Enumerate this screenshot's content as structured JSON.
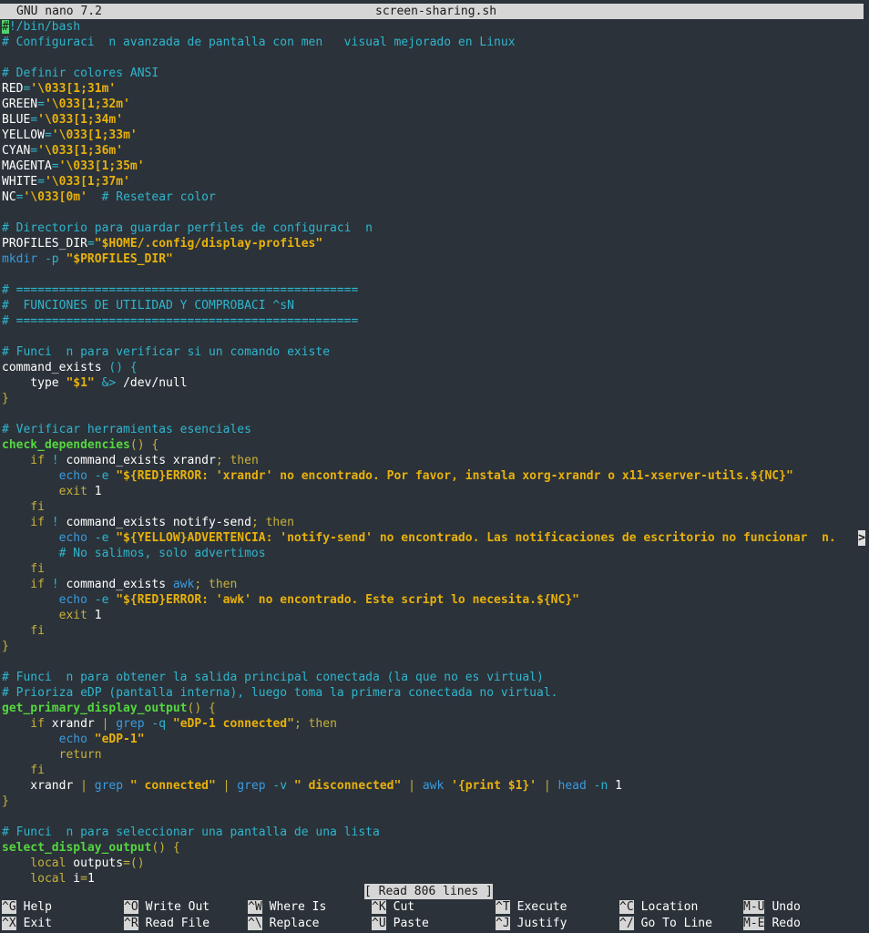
{
  "titlebar": {
    "app": "GNU nano 7.2",
    "file": "screen-sharing.sh"
  },
  "lines": [
    [
      [
        "cursor",
        "#"
      ],
      [
        "cmt",
        "!/bin/bash"
      ]
    ],
    [
      [
        "cmt",
        "# Configuraci  n avanzada de pantalla con men   visual mejorado en Linux"
      ]
    ],
    [],
    [
      [
        "cmt",
        "# Definir colores ANSI"
      ]
    ],
    [
      [
        "w",
        "RED"
      ],
      [
        "cmt",
        "="
      ],
      [
        "str",
        "'\\033[1;31m'"
      ]
    ],
    [
      [
        "w",
        "GREEN"
      ],
      [
        "cmt",
        "="
      ],
      [
        "str",
        "'\\033[1;32m'"
      ]
    ],
    [
      [
        "w",
        "BLUE"
      ],
      [
        "cmt",
        "="
      ],
      [
        "str",
        "'\\033[1;34m'"
      ]
    ],
    [
      [
        "w",
        "YELLOW"
      ],
      [
        "cmt",
        "="
      ],
      [
        "str",
        "'\\033[1;33m'"
      ]
    ],
    [
      [
        "w",
        "CYAN"
      ],
      [
        "cmt",
        "="
      ],
      [
        "str",
        "'\\033[1;36m'"
      ]
    ],
    [
      [
        "w",
        "MAGENTA"
      ],
      [
        "cmt",
        "="
      ],
      [
        "str",
        "'\\033[1;35m'"
      ]
    ],
    [
      [
        "w",
        "WHITE"
      ],
      [
        "cmt",
        "="
      ],
      [
        "str",
        "'\\033[1;37m'"
      ]
    ],
    [
      [
        "w",
        "NC"
      ],
      [
        "cmt",
        "="
      ],
      [
        "str",
        "'\\033[0m'"
      ],
      [
        "cmt",
        "  # Resetear color"
      ]
    ],
    [],
    [
      [
        "cmt",
        "# Directorio para guardar perfiles de configuraci  n"
      ]
    ],
    [
      [
        "w",
        "PROFILES_DIR"
      ],
      [
        "cmt",
        "="
      ],
      [
        "str",
        "\"$HOME/.config/display-profiles\""
      ]
    ],
    [
      [
        "cmd",
        "mkdir"
      ],
      [
        "cmt",
        " -p "
      ],
      [
        "str",
        "\"$PROFILES_DIR\""
      ]
    ],
    [],
    [
      [
        "cmt",
        "# ================================================"
      ]
    ],
    [
      [
        "cmt",
        "#  FUNCIONES DE UTILIDAD Y COMPROBACI ^sN"
      ]
    ],
    [
      [
        "cmt",
        "# ================================================"
      ]
    ],
    [],
    [
      [
        "cmt",
        "# Funci  n para verificar si un comando existe"
      ]
    ],
    [
      [
        "w",
        "command_exists"
      ],
      [
        "cmt",
        " () {"
      ]
    ],
    [
      [
        "w",
        "    type "
      ],
      [
        "str",
        "\"$1\""
      ],
      [
        "cmt",
        " &> "
      ],
      [
        "w",
        "/dev/null"
      ]
    ],
    [
      [
        "kw",
        "}"
      ]
    ],
    [],
    [
      [
        "cmt",
        "# Verificar herramientas esenciales"
      ]
    ],
    [
      [
        "fn",
        "check_dependencies"
      ],
      [
        "kw",
        "() {"
      ]
    ],
    [
      [
        "kw",
        "    if "
      ],
      [
        "cmt",
        "! "
      ],
      [
        "w",
        "command_exists xrandr"
      ],
      [
        "kw",
        "; then"
      ]
    ],
    [
      [
        "cmd",
        "        echo"
      ],
      [
        "cmt",
        " -e "
      ],
      [
        "str",
        "\"${RED}ERROR: 'xrandr' no encontrado. Por favor, instala xorg-xrandr o x11-xserver-utils.${NC}\""
      ]
    ],
    [
      [
        "kw",
        "        exit "
      ],
      [
        "w",
        "1"
      ]
    ],
    [
      [
        "kw",
        "    fi"
      ]
    ],
    [
      [
        "kw",
        "    if "
      ],
      [
        "cmt",
        "! "
      ],
      [
        "w",
        "command_exists notify-send"
      ],
      [
        "kw",
        "; then"
      ]
    ],
    [
      [
        "cmd",
        "        echo"
      ],
      [
        "cmt",
        " -e "
      ],
      [
        "str",
        "\"${YELLOW}ADVERTENCIA: 'notify-send' no encontrado. Las notificaciones de escritorio no funcionar  n."
      ],
      [
        "more",
        ">"
      ]
    ],
    [
      [
        "cmt",
        "        # No salimos, solo advertimos"
      ]
    ],
    [
      [
        "kw",
        "    fi"
      ]
    ],
    [
      [
        "kw",
        "    if "
      ],
      [
        "cmt",
        "! "
      ],
      [
        "w",
        "command_exists "
      ],
      [
        "cmd",
        "awk"
      ],
      [
        "kw",
        "; then"
      ]
    ],
    [
      [
        "cmd",
        "        echo"
      ],
      [
        "cmt",
        " -e "
      ],
      [
        "str",
        "\"${RED}ERROR: 'awk' no encontrado. Este script lo necesita.${NC}\""
      ]
    ],
    [
      [
        "kw",
        "        exit "
      ],
      [
        "w",
        "1"
      ]
    ],
    [
      [
        "kw",
        "    fi"
      ]
    ],
    [
      [
        "kw",
        "}"
      ]
    ],
    [],
    [
      [
        "cmt",
        "# Funci  n para obtener la salida principal conectada (la que no es virtual)"
      ]
    ],
    [
      [
        "cmt",
        "# Prioriza eDP (pantalla interna), luego toma la primera conectada no virtual."
      ]
    ],
    [
      [
        "fn",
        "get_primary_display_output"
      ],
      [
        "kw",
        "() {"
      ]
    ],
    [
      [
        "kw",
        "    if "
      ],
      [
        "w",
        "xrandr "
      ],
      [
        "kw",
        "| "
      ],
      [
        "cmd",
        "grep"
      ],
      [
        "cmt",
        " -q "
      ],
      [
        "str",
        "\"eDP-1 connected\""
      ],
      [
        "kw",
        "; then"
      ]
    ],
    [
      [
        "cmd",
        "        echo "
      ],
      [
        "str",
        "\"eDP-1\""
      ]
    ],
    [
      [
        "kw",
        "        return"
      ]
    ],
    [
      [
        "kw",
        "    fi"
      ]
    ],
    [
      [
        "w",
        "    xrandr "
      ],
      [
        "kw",
        "| "
      ],
      [
        "cmd",
        "grep "
      ],
      [
        "str",
        "\" connected\""
      ],
      [
        "kw",
        " | "
      ],
      [
        "cmd",
        "grep"
      ],
      [
        "cmt",
        " -v "
      ],
      [
        "str",
        "\" disconnected\""
      ],
      [
        "kw",
        " | "
      ],
      [
        "cmd",
        "awk "
      ],
      [
        "str",
        "'{print $1}'"
      ],
      [
        "kw",
        " | "
      ],
      [
        "cmd",
        "head"
      ],
      [
        "cmt",
        " -n "
      ],
      [
        "w",
        "1"
      ]
    ],
    [
      [
        "kw",
        "}"
      ]
    ],
    [],
    [
      [
        "cmt",
        "# Funci  n para seleccionar una pantalla de una lista"
      ]
    ],
    [
      [
        "fn",
        "select_display_output"
      ],
      [
        "kw",
        "() {"
      ]
    ],
    [
      [
        "kw",
        "    local "
      ],
      [
        "w",
        "outputs"
      ],
      [
        "kw",
        "=()"
      ]
    ],
    [
      [
        "kw",
        "    local "
      ],
      [
        "w",
        "i"
      ],
      [
        "kw",
        "="
      ],
      [
        "w",
        "1"
      ]
    ]
  ],
  "status_message": "[ Read 806 lines ]",
  "shortcuts": [
    {
      "key": "^G",
      "label": "Help",
      "name": "help"
    },
    {
      "key": "^O",
      "label": "Write Out",
      "name": "write-out"
    },
    {
      "key": "^W",
      "label": "Where Is",
      "name": "where-is"
    },
    {
      "key": "^K",
      "label": "Cut",
      "name": "cut"
    },
    {
      "key": "^T",
      "label": "Execute",
      "name": "execute"
    },
    {
      "key": "^C",
      "label": "Location",
      "name": "location"
    },
    {
      "key": "M-U",
      "label": "Undo",
      "name": "undo"
    },
    {
      "key": "^X",
      "label": "Exit",
      "name": "exit"
    },
    {
      "key": "^R",
      "label": "Read File",
      "name": "read-file"
    },
    {
      "key": "^\\",
      "label": "Replace",
      "name": "replace"
    },
    {
      "key": "^U",
      "label": "Paste",
      "name": "paste"
    },
    {
      "key": "^J",
      "label": "Justify",
      "name": "justify"
    },
    {
      "key": "^/",
      "label": "Go To Line",
      "name": "go-to-line"
    },
    {
      "key": "M-E",
      "label": "Redo",
      "name": "redo"
    }
  ]
}
